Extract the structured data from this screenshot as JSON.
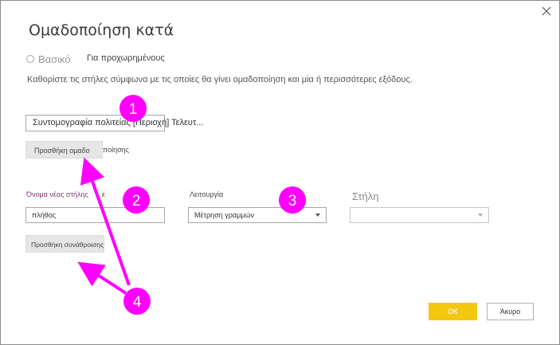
{
  "dialog": {
    "title": "Ομαδοποίηση κατά",
    "close_icon": "close-icon"
  },
  "mode": {
    "basic_label": "Βασικό",
    "advanced_label": "Για προχωρημένους"
  },
  "instruction": "Καθορίστε τις στήλες σύμφωνα με τις οποίες θα γίνει ομαδοποίηση και μία ή περισσότερες εξόδους.",
  "group_by": {
    "field_value": "Συντομογραφία πολιτείας [Περιοχή] Τελευτ...",
    "add_button": "Προσθήκη ομαδο",
    "add_button_tail": "ποίησης"
  },
  "aggregation": {
    "new_column_label": "Όνομα νέας στήλης",
    "new_column_label_tail": "ε",
    "new_column_value": "πλήθος",
    "operation_label": "Λειτουργία",
    "operation_value": "Μέτρηση γραμμών",
    "column_label": "Στήλη",
    "column_value": "",
    "add_button": "Προσθήκη συνάθροισης"
  },
  "footer": {
    "ok_label": "ΟΚ",
    "cancel_label": "Άκυρο"
  },
  "callouts": {
    "color": "#ff00ff",
    "badges": [
      "1",
      "2",
      "3",
      "4"
    ]
  }
}
